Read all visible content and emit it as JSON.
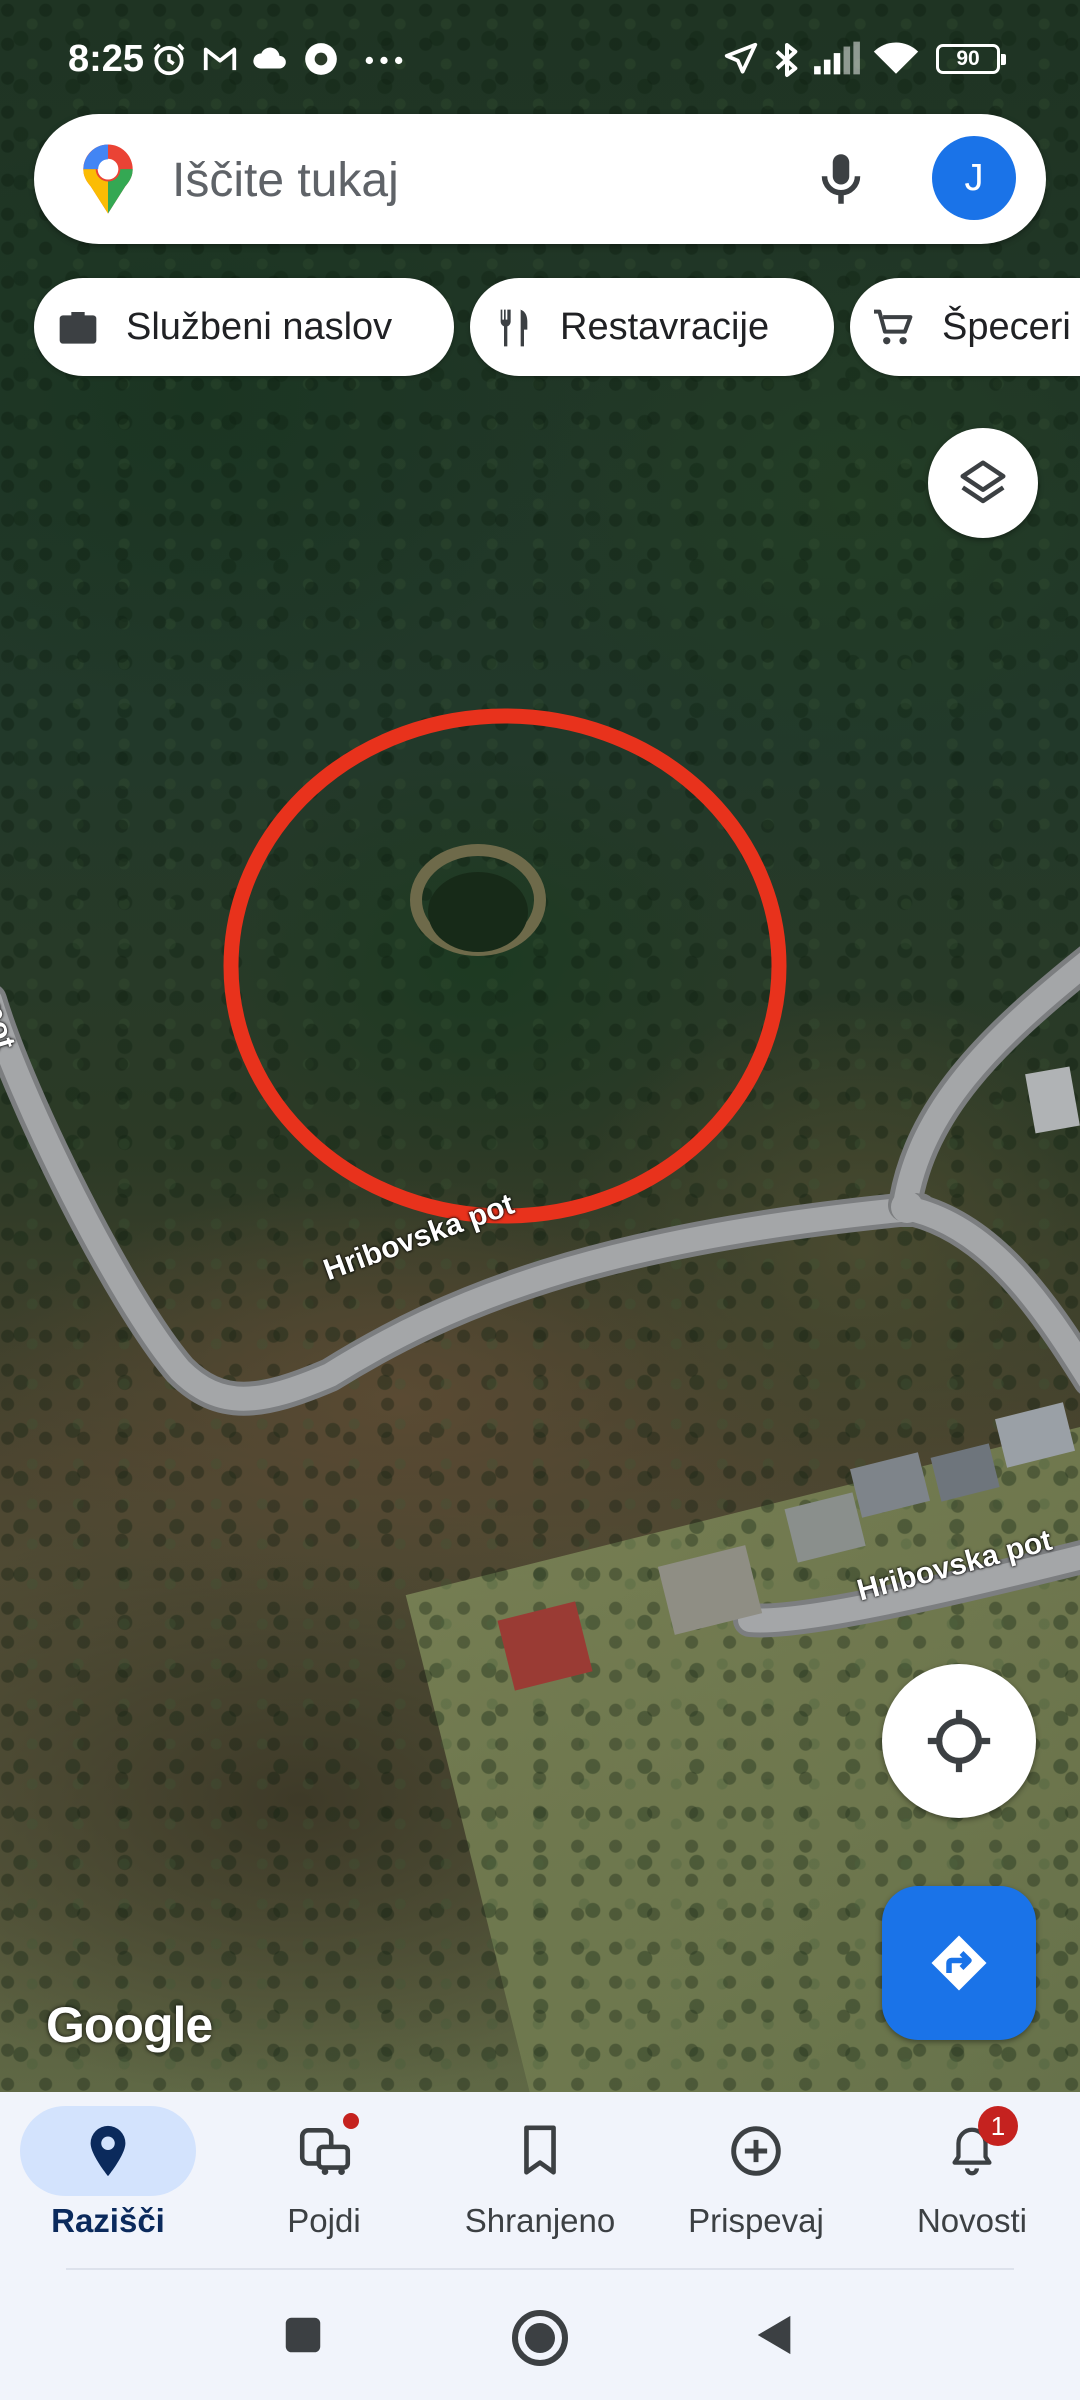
{
  "status_bar": {
    "time": "8:25",
    "battery": "90",
    "icons": [
      "alarm-icon",
      "gmail-icon",
      "cloud-icon",
      "chrome-icon",
      "more-dots-icon",
      "location-arrow-icon",
      "bluetooth-icon",
      "signal-icon",
      "wifi-icon",
      "battery-icon"
    ]
  },
  "search": {
    "placeholder": "Iščite tukaj",
    "avatar_initial": "J"
  },
  "chips": [
    {
      "label": "Službeni naslov",
      "icon": "briefcase-icon"
    },
    {
      "label": "Restavracije",
      "icon": "fork-knife-icon"
    },
    {
      "label": "Špeceri",
      "icon": "cart-icon"
    }
  ],
  "map": {
    "road_labels": [
      "Hribovska pot",
      "Hribovska pot",
      "... pot"
    ],
    "logo": "Google",
    "highlight_color": "#e8321c"
  },
  "bottom_nav": {
    "items": [
      {
        "label": "Razišči",
        "icon": "place-pin-icon",
        "active": true
      },
      {
        "label": "Pojdi",
        "icon": "commute-icon",
        "dot": true
      },
      {
        "label": "Shranjeno",
        "icon": "bookmark-icon"
      },
      {
        "label": "Prispevaj",
        "icon": "add-circle-icon"
      },
      {
        "label": "Novosti",
        "icon": "bell-icon",
        "badge": "1"
      }
    ]
  },
  "system_nav": [
    "recents-button",
    "home-button",
    "back-button"
  ],
  "colors": {
    "accent": "#1a73e8",
    "badge": "#c5221f"
  }
}
